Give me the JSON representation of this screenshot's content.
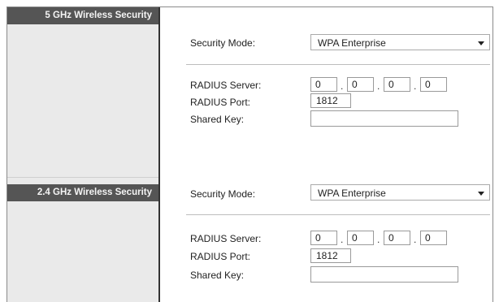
{
  "sections": {
    "ghz5": {
      "header": "5 GHz Wireless Security",
      "security_mode_label": "Security Mode:",
      "security_mode_value": "WPA Enterprise",
      "radius_server_label": "RADIUS Server:",
      "radius_server_octets": [
        "0",
        "0",
        "0",
        "0"
      ],
      "radius_port_label": "RADIUS Port:",
      "radius_port_value": "1812",
      "shared_key_label": "Shared Key:",
      "shared_key_value": ""
    },
    "ghz24": {
      "header": "2.4 GHz Wireless Security",
      "security_mode_label": "Security Mode:",
      "security_mode_value": "WPA Enterprise",
      "radius_server_label": "RADIUS Server:",
      "radius_server_octets": [
        "0",
        "0",
        "0",
        "0"
      ],
      "radius_port_label": "RADIUS Port:",
      "radius_port_value": "1812",
      "shared_key_label": "Shared Key:",
      "shared_key_value": ""
    }
  },
  "ip_separator": ".",
  "icons": {
    "dropdown": "chevron-down-icon"
  },
  "colors": {
    "sidebar_header_bg": "#555555",
    "sidebar_bg": "#eaeaea",
    "separator": "#bdbdbd"
  }
}
